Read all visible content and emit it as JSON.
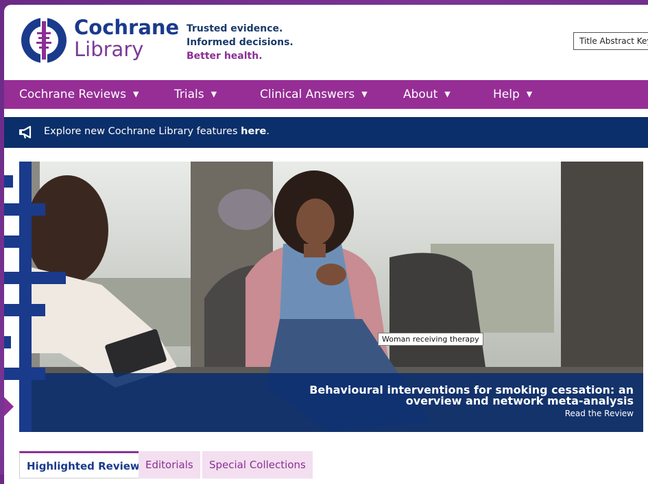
{
  "brand": {
    "name_line1": "Cochrane",
    "name_line2": "Library",
    "tagline": [
      "Trusted evidence.",
      "Informed decisions.",
      "Better health."
    ]
  },
  "search": {
    "scope_value": "Title Abstract Keyword"
  },
  "nav": {
    "items": [
      {
        "label": "Cochrane Reviews"
      },
      {
        "label": "Trials"
      },
      {
        "label": "Clinical Answers"
      },
      {
        "label": "About"
      },
      {
        "label": "Help"
      }
    ]
  },
  "announcement": {
    "icon": "megaphone-icon",
    "text": "Explore new Cochrane Library features ",
    "link": "here",
    "suffix": "."
  },
  "hero": {
    "image_alt_tooltip": "Woman receiving therapy",
    "title": "Behavioural interventions for smoking cessation: an overview and network meta-analysis",
    "link": "Read the Review"
  },
  "tabs": [
    {
      "label": "Highlighted Reviews",
      "active": true
    },
    {
      "label": "Editorials",
      "active": false
    },
    {
      "label": "Special Collections",
      "active": false
    }
  ],
  "colors": {
    "primary_purple": "#962e96",
    "navy": "#0b2f6a",
    "logo_blue": "#1a3a8c",
    "tab_bg": "#f3dff0"
  }
}
